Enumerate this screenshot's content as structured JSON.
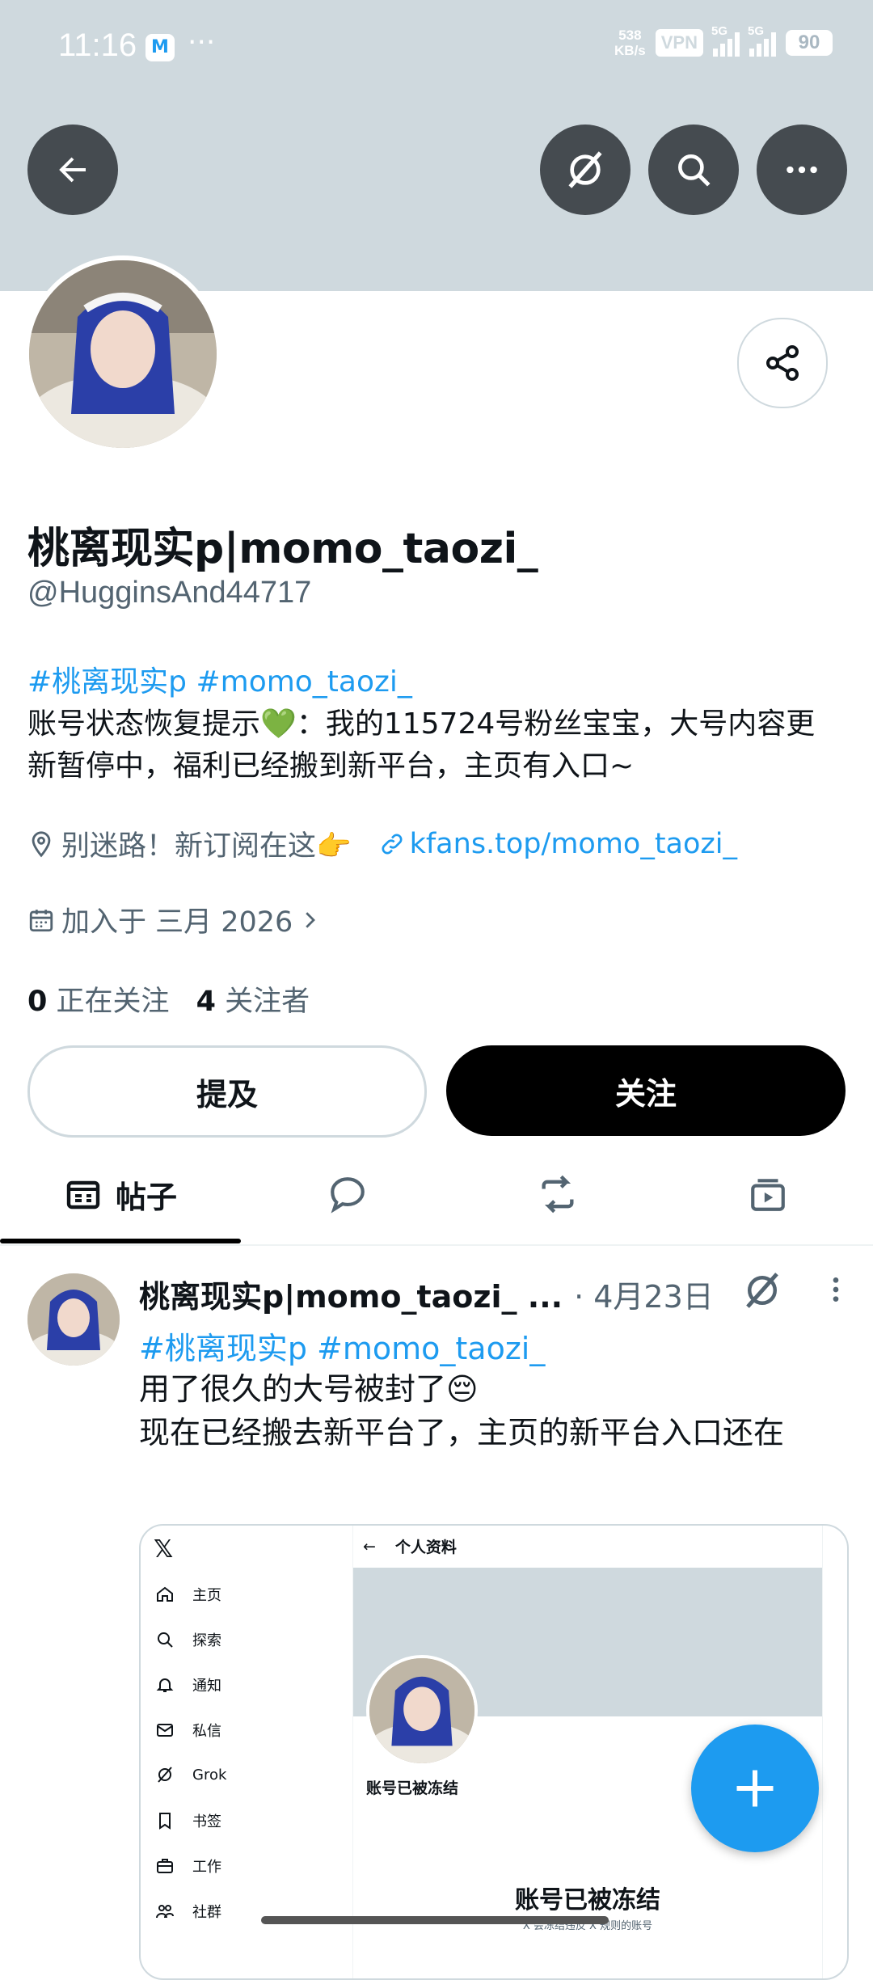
{
  "status_bar": {
    "time": "11:16",
    "app_badge": "M",
    "more_dots": "···",
    "net_speed_value": "538",
    "net_speed_unit": "KB/s",
    "vpn": "VPN",
    "signal1": "5G",
    "signal2": "5G",
    "battery": "90"
  },
  "header_icons": [
    "back-arrow-icon",
    "grok-icon",
    "search-icon",
    "more-icon"
  ],
  "profile": {
    "display_name": "桃离现实p|momo_taozi_",
    "handle": "@HugginsAnd44717",
    "bio_tags": "#桃离现实p #momo_taozi_",
    "bio_text": "账号状态恢复提示💚：我的115724号粉丝宝宝，大号内容更新暂停中，福利已经搬到新平台，主页有入口~",
    "location": "别迷路！新订阅在这👉",
    "website": "kfans.top/momo_taozi_",
    "joined": "加入于 三月 2026",
    "following_count": "0",
    "following_label": "正在关注",
    "followers_count": "4",
    "followers_label": "关注者"
  },
  "buttons": {
    "mention": "提及",
    "follow": "关注"
  },
  "tabs": [
    {
      "label": "帖子",
      "icon": "posts-icon"
    },
    {
      "label": "",
      "icon": "replies-icon"
    },
    {
      "label": "",
      "icon": "repost-icon"
    },
    {
      "label": "",
      "icon": "media-icon"
    }
  ],
  "post": {
    "name": "桃离现实p|momo_taozi_ ...",
    "date": "· 4月23日",
    "tags": "#桃离现实p #momo_taozi_",
    "text_line1": "用了很久的大号被封了😔",
    "text_line2": "现在已经搬去新平台了，主页的新平台入口还在",
    "embed": {
      "logo": "𝕏",
      "nav": [
        "主页",
        "探索",
        "通知",
        "私信",
        "Grok",
        "书签",
        "工作",
        "社群"
      ],
      "header_title": "个人资料",
      "frozen_small": "账号已被冻结",
      "frozen_big": "账号已被冻结",
      "frozen_note": "X 会冻结违反 X 规则的账号"
    }
  },
  "colors": {
    "accent": "#1d9bf0",
    "banner": "#cfd9de",
    "text": "#0f1419",
    "secondary": "#536471"
  }
}
